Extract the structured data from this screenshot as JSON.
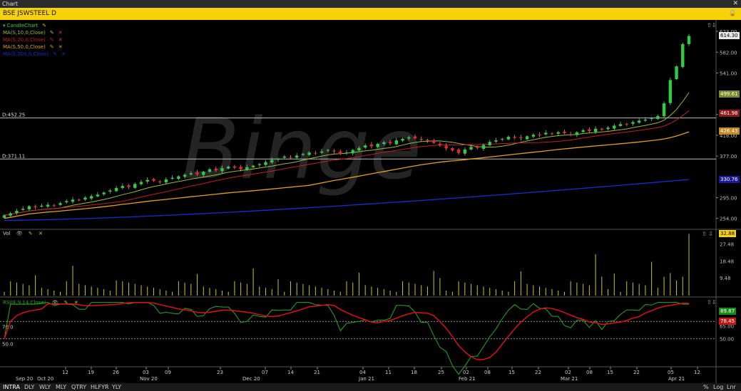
{
  "window": {
    "title": "Chart"
  },
  "symbol": {
    "title": "BSE JSWSTEEL D"
  },
  "bottom_tabs": [
    "INTRA",
    "DLY",
    "WLY",
    "MLY",
    "QTRY",
    "HLFYR",
    "YLY"
  ],
  "bottom_right": [
    "%",
    "Log",
    "Lnr"
  ],
  "watermark": "Binge",
  "price_pane": {
    "legend": [
      "CandleChart",
      "MA(S,10,0,Close)",
      "MA(S,20,0,Close)",
      "MA(S,50,0,Close)",
      "MA(S,200,0,Close)"
    ],
    "hlines": [
      {
        "label": "D:452.25",
        "value": 452.25
      },
      {
        "label": "D:371.11",
        "value": 371.11
      }
    ],
    "axis_ticks": [
      "623.00",
      "582.00",
      "541.00",
      "459.00",
      "418.00",
      "377.00",
      "295.00",
      "254.00"
    ],
    "tags": [
      {
        "text": "614.30",
        "value": 614.3,
        "bg": "#e8e8e8",
        "fg": "#000"
      },
      {
        "text": "499.61",
        "value": 499.61,
        "bg": "#7a8a2a",
        "fg": "#fff"
      },
      {
        "text": "461.98",
        "value": 461.98,
        "bg": "#8b1a1a",
        "fg": "#fff"
      },
      {
        "text": "426.43",
        "value": 426.43,
        "bg": "#c08a20",
        "fg": "#fff"
      },
      {
        "text": "330.76",
        "value": 330.76,
        "bg": "#1a1a9a",
        "fg": "#fff"
      }
    ]
  },
  "vol_pane": {
    "legend": "Vol",
    "axis_ticks": [
      "27.48",
      "18.48",
      "9.48"
    ],
    "tag": "32.88"
  },
  "rsi_pane": {
    "legend": "RSI(E,9,14,Close)",
    "levels": [
      "70.0",
      "50.0"
    ],
    "axis_ticks": [
      "65.00",
      "50.00"
    ],
    "tags": [
      {
        "text": "89.87",
        "bg": "#1a8a1a"
      },
      {
        "text": "78.45",
        "bg": "#c01818"
      }
    ]
  },
  "x_axis": {
    "day_labels": [
      "12",
      "19",
      "26",
      "03",
      "09",
      "23",
      "07",
      "14",
      "21",
      "04",
      "11",
      "18",
      "25",
      "02",
      "08",
      "15",
      "22",
      "02",
      "08",
      "15",
      "22",
      "05",
      "12"
    ],
    "month_labels": [
      "Sep 20",
      "Oct 20",
      "Nov 20",
      "Dec 20",
      "Jan 21",
      "Feb 21",
      "Mar 21",
      "Apr 21"
    ]
  },
  "colors": {
    "up": "#2ecc40",
    "down": "#e8232a",
    "ma10": "#9ab83a",
    "ma20": "#c02020",
    "ma50": "#e0a020",
    "ma200": "#1c2bd0",
    "vol": "#c8c820",
    "rsi": "#22aa22",
    "rsi_signal": "#dd1111"
  },
  "chart_data": {
    "type": "candlestick",
    "ylim": [
      238,
      640
    ],
    "closes": [
      260,
      264,
      269,
      273,
      278,
      276,
      279,
      281,
      280,
      284,
      288,
      291,
      290,
      295,
      298,
      301,
      305,
      309,
      314,
      318,
      316,
      322,
      326,
      330,
      328,
      325,
      331,
      334,
      337,
      340,
      343,
      341,
      346,
      351,
      349,
      353,
      356,
      354,
      351,
      355,
      358,
      361,
      365,
      369,
      372,
      376,
      374,
      378,
      381,
      384,
      383,
      386,
      389,
      386,
      381,
      384,
      389,
      393,
      398,
      396,
      401,
      404,
      402,
      408,
      411,
      414,
      412,
      409,
      407,
      403,
      398,
      392,
      388,
      383,
      390,
      395,
      393,
      399,
      405,
      408,
      411,
      415,
      413,
      412,
      416,
      419,
      418,
      423,
      421,
      424,
      422,
      419,
      424,
      428,
      426,
      431,
      429,
      433,
      437,
      440,
      439,
      444,
      447,
      449,
      452,
      456,
      481,
      527,
      554,
      598,
      614
    ]
  }
}
